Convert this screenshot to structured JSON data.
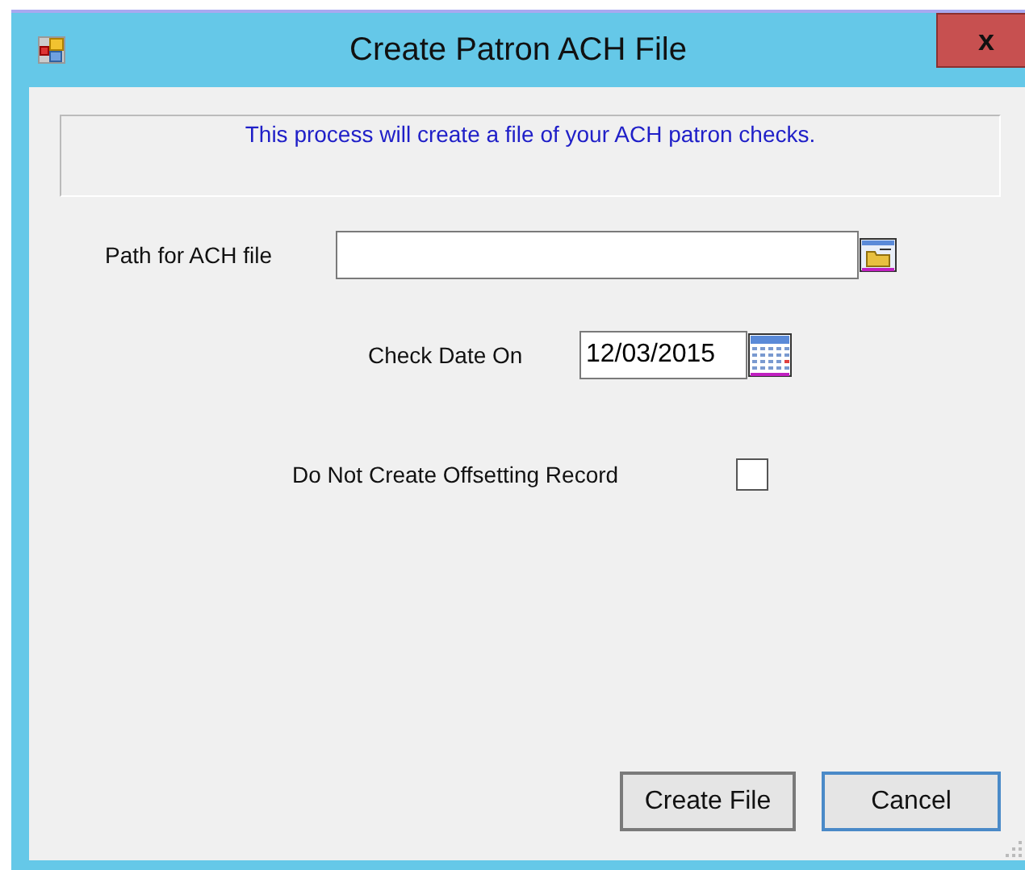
{
  "window": {
    "title": "Create Patron ACH File",
    "close": "x"
  },
  "info": {
    "text": "This process will create a file of your ACH patron checks."
  },
  "path": {
    "label": "Path for ACH file"
  },
  "check_date": {
    "label": "Check Date On",
    "value": "12/03/2015"
  },
  "offset": {
    "label": "Do Not Create Offsetting Record",
    "checked": false
  },
  "buttons": [
    {
      "label": "Create File",
      "kind": "plain"
    },
    {
      "label": "Cancel",
      "kind": "default"
    }
  ]
}
